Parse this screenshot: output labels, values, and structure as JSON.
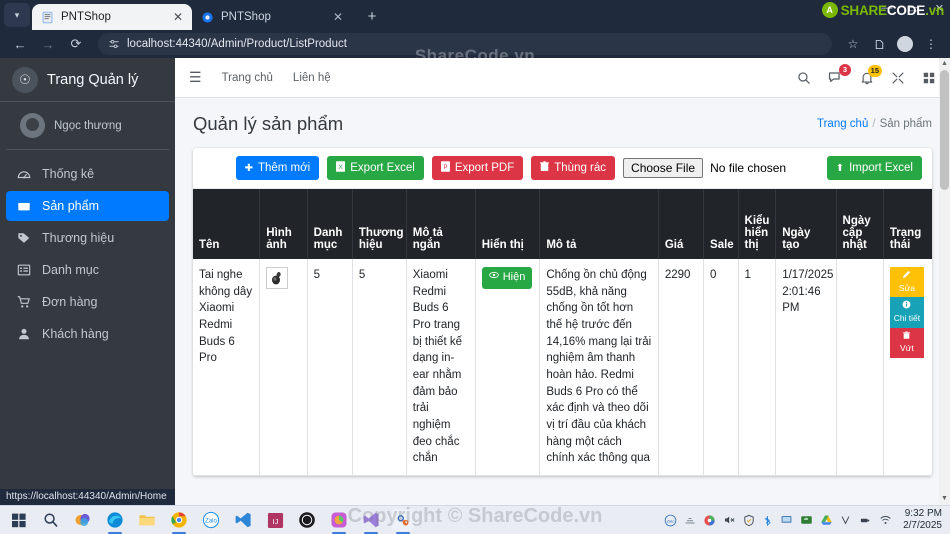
{
  "browser": {
    "tabs": [
      {
        "title": "PNTShop",
        "favicon": "document-icon",
        "active": true
      },
      {
        "title": "PNTShop",
        "favicon": "globe-icon",
        "active": false
      }
    ],
    "new_tab_label": "+",
    "url": "localhost:44340/Admin/Product/ListProduct",
    "status_url": "https://localhost:44340/Admin/Home",
    "window_controls": {
      "minimize": "—",
      "maximize": "▭",
      "close": "✕"
    }
  },
  "watermarks": {
    "top": "ShareCode.vn",
    "bottom": "Copyright © ShareCode.vn",
    "logo": {
      "share": "SHARE",
      "code": "CODE",
      "vn": ".vn",
      "mark": "A"
    }
  },
  "sidebar": {
    "brand": "Trang Quản lý",
    "user": "Ngọc thương",
    "items": [
      {
        "label": "Thống kê",
        "icon": "dashboard-icon",
        "active": false
      },
      {
        "label": "Sản phẩm",
        "icon": "box-icon",
        "active": true
      },
      {
        "label": "Thương hiệu",
        "icon": "tag-icon",
        "active": false
      },
      {
        "label": "Danh mục",
        "icon": "list-icon",
        "active": false
      },
      {
        "label": "Đơn hàng",
        "icon": "cart-icon",
        "active": false
      },
      {
        "label": "Khách hàng",
        "icon": "user-icon",
        "active": false
      }
    ]
  },
  "navbar": {
    "links": [
      "Trang chủ",
      "Liên hệ"
    ],
    "message_badge": "3",
    "notification_badge": "15"
  },
  "page": {
    "title": "Quản lý sản phẩm",
    "breadcrumb_home": "Trang chủ",
    "breadcrumb_sep": "/",
    "breadcrumb_current": "Sản phẩm"
  },
  "toolbar": {
    "add_label": "Thêm mới",
    "export_excel_label": "Export Excel",
    "export_pdf_label": "Export PDF",
    "trash_label": "Thùng rác",
    "choose_file_label": "Choose File",
    "no_file_label": "No file chosen",
    "import_excel_label": "Import Excel"
  },
  "table": {
    "columns": [
      "Tên",
      "Hình ảnh",
      "Danh mục",
      "Thương hiệu",
      "Mô tả ngắn",
      "Hiển thị",
      "Mô tả",
      "Giá",
      "Sale",
      "Kiểu hiển thị",
      "Ngày tạo",
      "Ngày cập nhật",
      "Trạng thái"
    ],
    "rows": [
      {
        "name": "Tai nghe không dây Xiaomi Redmi Buds 6 Pro",
        "image": "earbuds-thumbnail",
        "category": "5",
        "brand": "5",
        "short_desc": "Xiaomi Redmi Buds 6 Pro trang bị thiết kế dạng in-ear nhằm đảm bảo trải nghiệm đeo chắc chắn",
        "display_label": "Hiện",
        "description": "Chống ồn chủ động 55dB, khả năng chống ồn tốt hơn thế hệ trước đến 14,16% mang lại trải nghiệm âm thanh hoàn hảo. Redmi Buds 6 Pro có thể xác định và theo dõi vị trí đầu của khách hàng một cách chính xác thông qua",
        "price": "2290",
        "sale": "0",
        "display_type": "1",
        "created_at": "1/17/2025 2:01:46 PM",
        "updated_at": "",
        "actions": [
          {
            "label": "Sửa",
            "icon": "pencil-icon",
            "color": "#ffc107"
          },
          {
            "label": "Chi tiết",
            "icon": "info-icon",
            "color": "#17a2b8"
          },
          {
            "label": "Vứt",
            "icon": "trash-icon",
            "color": "#dc3545"
          }
        ]
      }
    ]
  },
  "taskbar": {
    "apps": [
      "windows-start-icon",
      "search-icon",
      "copilot-icon",
      "edge-icon",
      "file-explorer-icon",
      "chrome-icon",
      "zalo-icon",
      "vscode-icon",
      "jetbrains-icon",
      "chatgpt-icon",
      "photos-icon",
      "visual-studio-icon",
      "settings-icon"
    ],
    "tray": [
      "zalo-tray-icon",
      "network-tray-icon",
      "color-tray-icon",
      "volume-muted-icon",
      "security-icon",
      "bluetooth-icon",
      "monitor-icon",
      "nvidia-icon",
      "drive-icon",
      "v-icon",
      "usb-icon",
      "wifi-icon"
    ],
    "time": "9:32 PM",
    "date": "2/7/2025"
  }
}
